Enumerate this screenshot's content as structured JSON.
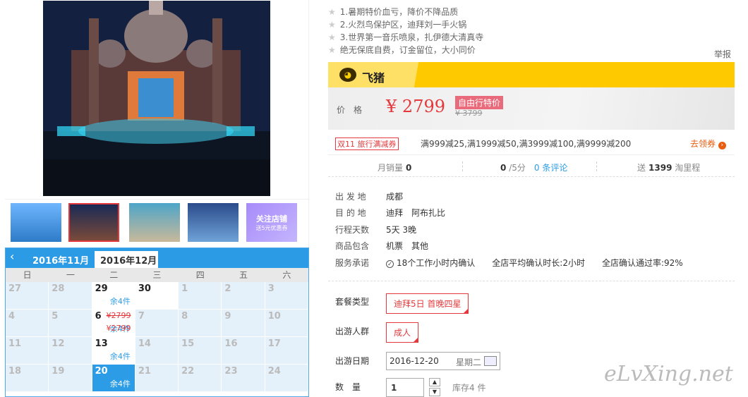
{
  "gallery": {
    "main_image": "dubai-palace-night-photo",
    "thumb_label": "关注店铺",
    "thumb_sub": "送5元优惠券"
  },
  "calendar": {
    "months": [
      "2016年11月",
      "2016年12月"
    ],
    "weekdays": [
      "日",
      "一",
      "二",
      "三",
      "四",
      "五",
      "六"
    ],
    "rows": [
      [
        {
          "d": "27"
        },
        {
          "d": "28"
        },
        {
          "d": "29",
          "active": true,
          "stock": "余4件"
        },
        {
          "d": "30",
          "white": true
        },
        {
          "d": "1"
        },
        {
          "d": "2"
        },
        {
          "d": "3"
        }
      ],
      [
        {
          "d": "4"
        },
        {
          "d": "5"
        },
        {
          "d": "6",
          "active": true,
          "stock": "余4件",
          "price_old": "¥2799",
          "price": "¥2799"
        },
        {
          "d": "7"
        },
        {
          "d": "8"
        },
        {
          "d": "9"
        },
        {
          "d": "10"
        }
      ],
      [
        {
          "d": "11"
        },
        {
          "d": "12"
        },
        {
          "d": "13",
          "active": true,
          "stock": "余4件"
        },
        {
          "d": "14"
        },
        {
          "d": "15"
        },
        {
          "d": "16"
        },
        {
          "d": "17"
        }
      ],
      [
        {
          "d": "18"
        },
        {
          "d": "19"
        },
        {
          "d": "20",
          "selected": true,
          "stock": "余4件"
        },
        {
          "d": "21"
        },
        {
          "d": "22"
        },
        {
          "d": "23"
        },
        {
          "d": "24"
        }
      ]
    ]
  },
  "highlights": [
    "1.暑期特价血亏，降价不降品质",
    "2.火烈鸟保护区，迪拜刘一手火锅",
    "3.世界第一音乐喷泉，扎伊德大清真寺",
    "绝无保底自费，订金留位，大小同价"
  ],
  "report": "举报",
  "brand": {
    "name": "飞猪",
    "logo_glyph": "◕"
  },
  "price": {
    "label": "价格",
    "symbol": "¥",
    "value": "2799",
    "tag": "自由行特价",
    "old": "¥ 3799"
  },
  "coupon": {
    "badge": "双11 旅行满减券",
    "text": "满999减25,满1999减50,满3999减100,满9999减200",
    "link": "去领券"
  },
  "stats": {
    "sales_label": "月销量",
    "sales": "0",
    "rating": "0",
    "rating_unit": "/5分",
    "reviews": "0 条评论",
    "mileage_pre": "送",
    "mileage": "1399",
    "mileage_post": "淘里程"
  },
  "info": [
    {
      "k": "出 发 地",
      "v": "成都"
    },
    {
      "k": "目 的 地",
      "v": "迪拜　阿布扎比"
    },
    {
      "k": "行程天数",
      "v": "5天 3晚"
    },
    {
      "k": "商品包含",
      "v": "机票　其他"
    },
    {
      "k": "服务承诺",
      "v": "18个工作小时内确认　　全店平均确认时长:2小时　　全店确认通过率:92%"
    }
  ],
  "form": {
    "package_label": "套餐类型",
    "package_value": "迪拜5日 首晚四星",
    "crowd_label": "出游人群",
    "crowd_value": "成人",
    "date_label": "出游日期",
    "date_value": "2016-12-20",
    "date_weekday": "星期二",
    "qty_label": "数　量",
    "qty_value": "1",
    "stock": "库存4 件"
  },
  "watermark": "eLvXing.net"
}
